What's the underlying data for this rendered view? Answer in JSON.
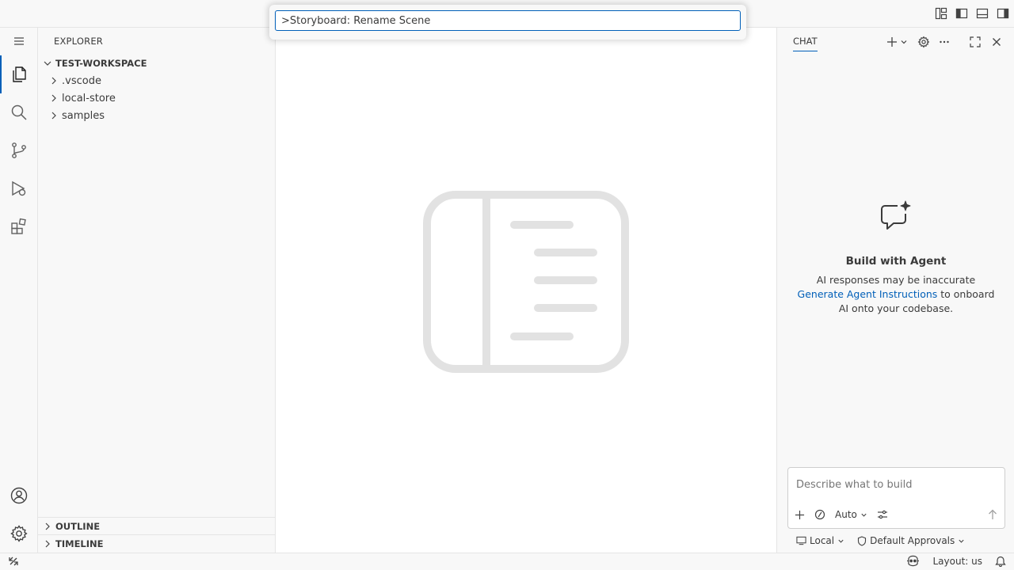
{
  "command_palette": {
    "value": ">Storyboard: Rename Scene"
  },
  "titlebar": {
    "icons": [
      "customize-layout-icon",
      "toggle-primary-sidebar-icon",
      "toggle-panel-icon",
      "toggle-secondary-sidebar-icon"
    ]
  },
  "activity_bar": {
    "items": [
      "menu-icon",
      "explorer-icon",
      "search-icon",
      "source-control-icon",
      "run-debug-icon",
      "extensions-icon"
    ],
    "bottom": [
      "accounts-icon",
      "manage-gear-icon"
    ]
  },
  "explorer": {
    "title": "EXPLORER",
    "root": "TEST-WORKSPACE",
    "items": [
      {
        "label": ".vscode"
      },
      {
        "label": "local-store"
      },
      {
        "label": "samples"
      }
    ],
    "outline_label": "OUTLINE",
    "timeline_label": "TIMELINE"
  },
  "chat": {
    "tab_label": "CHAT",
    "hero_title": "Build with Agent",
    "hero_line1": "AI responses may be inaccurate",
    "hero_link": "Generate Agent Instructions",
    "hero_line2": " to onboard AI onto your codebase.",
    "input_placeholder": "Describe what to build",
    "mode_label": "Auto",
    "location_label": "Local",
    "approvals_label": "Default Approvals"
  },
  "statusbar": {
    "layout_label": "Layout: us"
  },
  "colors": {
    "accent": "#005fb8",
    "chrome": "#f8f8f8",
    "border": "#e5e5e5"
  }
}
